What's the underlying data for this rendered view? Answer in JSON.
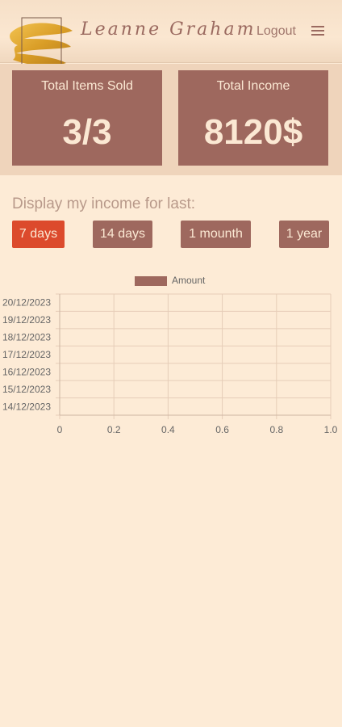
{
  "header": {
    "user_name": "Leanne Graham",
    "logout_label": "Logout"
  },
  "stats": {
    "items_sold": {
      "label": "Total Items Sold",
      "value": "3/3"
    },
    "income": {
      "label": "Total Income",
      "value": "8120$"
    }
  },
  "range": {
    "title": "Display my income for last:",
    "buttons": [
      {
        "label": "7 days",
        "active": true
      },
      {
        "label": "14 days",
        "active": false
      },
      {
        "label": "1 mounth",
        "active": false
      },
      {
        "label": "1 year",
        "active": false
      }
    ]
  },
  "colors": {
    "accent": "#dc4a2c",
    "card": "#9e685e",
    "background": "#fdebd6"
  },
  "chart_data": {
    "type": "bar",
    "orientation": "horizontal",
    "categories": [
      "20/12/2023",
      "19/12/2023",
      "18/12/2023",
      "17/12/2023",
      "16/12/2023",
      "15/12/2023",
      "14/12/2023"
    ],
    "series": [
      {
        "name": "Amount",
        "values": [
          0,
          0,
          0,
          0,
          0,
          0,
          0
        ],
        "color": "#9e685e"
      }
    ],
    "xlim": [
      0,
      1.0
    ],
    "xticks": [
      "0",
      "0.2",
      "0.4",
      "0.6",
      "0.8",
      "1.0"
    ],
    "grid": true,
    "legend": "top"
  }
}
